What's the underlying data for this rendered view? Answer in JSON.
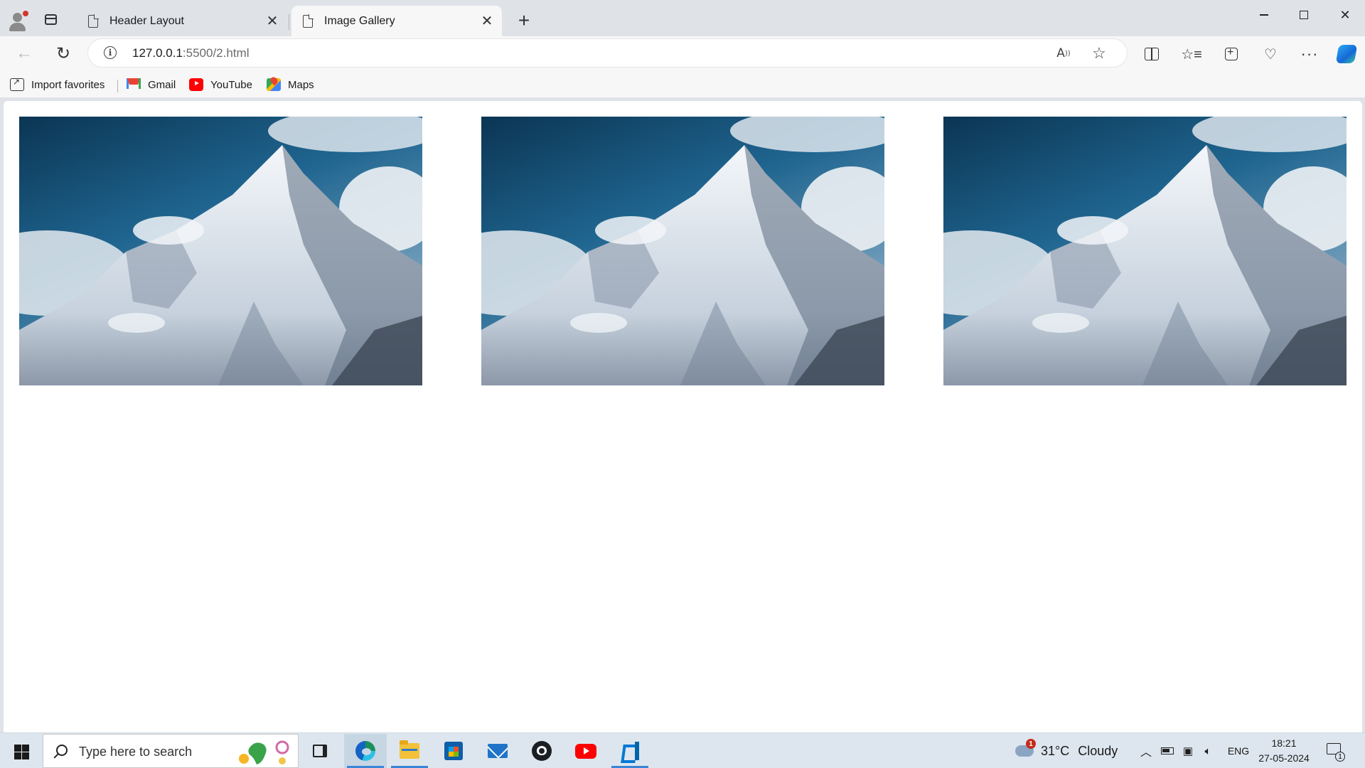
{
  "browser": {
    "tabs": [
      {
        "title": "Header Layout",
        "active": false
      },
      {
        "title": "Image Gallery",
        "active": true
      }
    ],
    "url_host": "127.0.0.1",
    "url_rest": ":5500/2.html",
    "favorites": [
      {
        "label": "Import favorites",
        "icon": "import-icon"
      },
      {
        "label": "Gmail",
        "icon": "gmail-icon"
      },
      {
        "label": "YouTube",
        "icon": "youtube-icon"
      },
      {
        "label": "Maps",
        "icon": "maps-icon"
      }
    ]
  },
  "page": {
    "gallery": [
      {
        "subject": "snow-capped mountain peak"
      },
      {
        "subject": "snow-capped mountain peak"
      },
      {
        "subject": "snow-capped mountain peak"
      }
    ]
  },
  "taskbar": {
    "search_placeholder": "Type here to search",
    "apps": [
      "task-view",
      "edge",
      "file-explorer",
      "microsoft-store",
      "mail",
      "github-desktop",
      "youtube",
      "vscode"
    ],
    "weather": {
      "temp": "31°C",
      "condition": "Cloudy",
      "badge": "1"
    },
    "language": "ENG",
    "time": "18:21",
    "date": "27-05-2024",
    "notifications": "1"
  }
}
